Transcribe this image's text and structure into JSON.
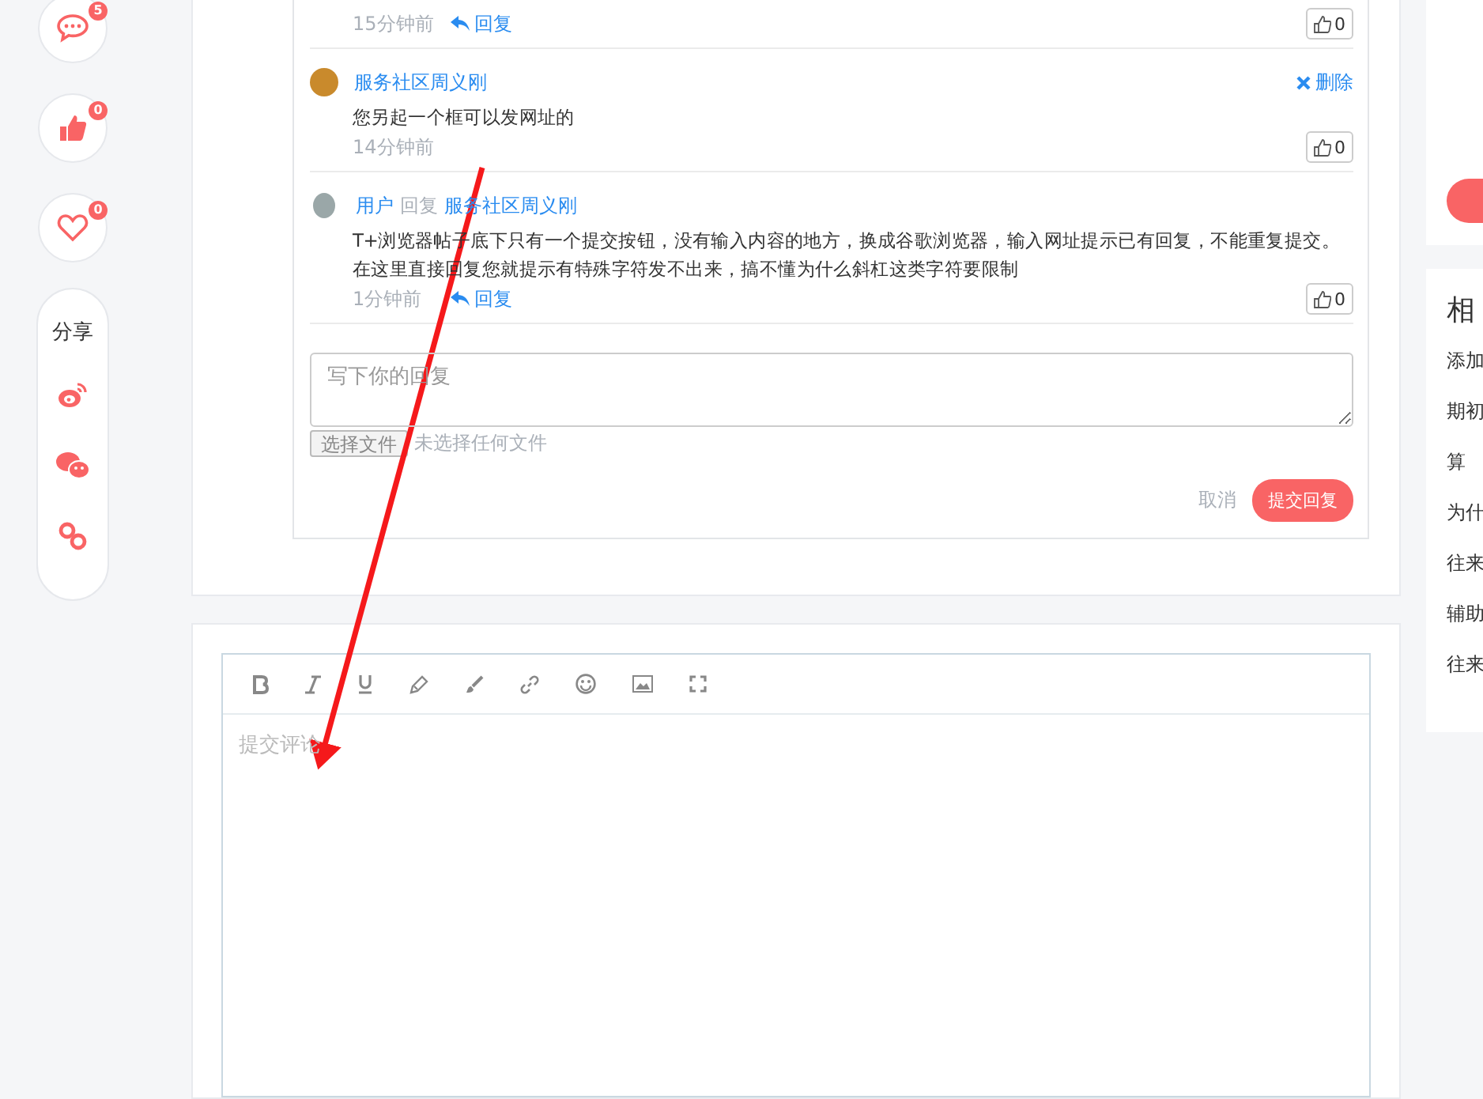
{
  "float_bar": {
    "actions": [
      {
        "kind": "comment",
        "count": "5"
      },
      {
        "kind": "like",
        "count": "0"
      },
      {
        "kind": "favorite",
        "count": "0"
      }
    ],
    "share": {
      "label": "分享",
      "items": [
        {
          "kind": "weibo"
        },
        {
          "kind": "wechat"
        },
        {
          "kind": "link"
        }
      ]
    }
  },
  "comments": [
    {
      "time": "15分钟前",
      "reply": "回复",
      "likes": "0"
    },
    {
      "author": "服务社区周义刚",
      "text": "您另起一个框可以发网址的",
      "time": "14分钟前",
      "delete": "删除",
      "likes": "0"
    },
    {
      "author": "用户",
      "reply_label": "回复",
      "reply_to": "服务社区周义刚",
      "text": "T+浏览器帖子底下只有一个提交按钮，没有输入内容的地方，换成谷歌浏览器，输入网址提示已有回复，不能重复提交。在这里直接回复您就提示有特殊字符发不出来，搞不懂为什么斜杠这类字符要限制",
      "time": "1分钟前",
      "reply": "回复",
      "likes": "0"
    }
  ],
  "reply_form": {
    "placeholder": "写下你的回复",
    "file_button": "选择文件",
    "file_status": "未选择任何文件",
    "cancel": "取消",
    "submit": "提交回复"
  },
  "editor": {
    "tools": [
      {
        "kind": "bold"
      },
      {
        "kind": "italic"
      },
      {
        "kind": "underline"
      },
      {
        "kind": "pencil"
      },
      {
        "kind": "brush"
      },
      {
        "kind": "link"
      },
      {
        "kind": "emoji"
      },
      {
        "kind": "image"
      },
      {
        "kind": "fullscreen"
      }
    ],
    "placeholder": "提交评论"
  },
  "related": {
    "title": "相",
    "items": [
      "添加",
      "期初",
      "算",
      "为什",
      "往来",
      "辅助",
      "往来"
    ]
  }
}
